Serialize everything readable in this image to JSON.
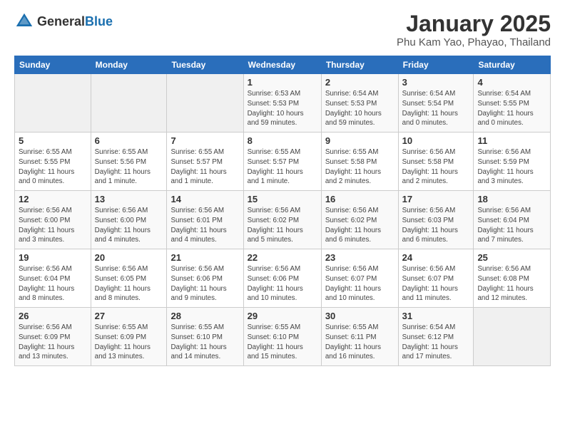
{
  "logo": {
    "general": "General",
    "blue": "Blue"
  },
  "title": "January 2025",
  "subtitle": "Phu Kam Yao, Phayao, Thailand",
  "days_of_week": [
    "Sunday",
    "Monday",
    "Tuesday",
    "Wednesday",
    "Thursday",
    "Friday",
    "Saturday"
  ],
  "weeks": [
    [
      {
        "day": "",
        "detail": ""
      },
      {
        "day": "",
        "detail": ""
      },
      {
        "day": "",
        "detail": ""
      },
      {
        "day": "1",
        "detail": "Sunrise: 6:53 AM\nSunset: 5:53 PM\nDaylight: 10 hours\nand 59 minutes."
      },
      {
        "day": "2",
        "detail": "Sunrise: 6:54 AM\nSunset: 5:53 PM\nDaylight: 10 hours\nand 59 minutes."
      },
      {
        "day": "3",
        "detail": "Sunrise: 6:54 AM\nSunset: 5:54 PM\nDaylight: 11 hours\nand 0 minutes."
      },
      {
        "day": "4",
        "detail": "Sunrise: 6:54 AM\nSunset: 5:55 PM\nDaylight: 11 hours\nand 0 minutes."
      }
    ],
    [
      {
        "day": "5",
        "detail": "Sunrise: 6:55 AM\nSunset: 5:55 PM\nDaylight: 11 hours\nand 0 minutes."
      },
      {
        "day": "6",
        "detail": "Sunrise: 6:55 AM\nSunset: 5:56 PM\nDaylight: 11 hours\nand 1 minute."
      },
      {
        "day": "7",
        "detail": "Sunrise: 6:55 AM\nSunset: 5:57 PM\nDaylight: 11 hours\nand 1 minute."
      },
      {
        "day": "8",
        "detail": "Sunrise: 6:55 AM\nSunset: 5:57 PM\nDaylight: 11 hours\nand 1 minute."
      },
      {
        "day": "9",
        "detail": "Sunrise: 6:55 AM\nSunset: 5:58 PM\nDaylight: 11 hours\nand 2 minutes."
      },
      {
        "day": "10",
        "detail": "Sunrise: 6:56 AM\nSunset: 5:58 PM\nDaylight: 11 hours\nand 2 minutes."
      },
      {
        "day": "11",
        "detail": "Sunrise: 6:56 AM\nSunset: 5:59 PM\nDaylight: 11 hours\nand 3 minutes."
      }
    ],
    [
      {
        "day": "12",
        "detail": "Sunrise: 6:56 AM\nSunset: 6:00 PM\nDaylight: 11 hours\nand 3 minutes."
      },
      {
        "day": "13",
        "detail": "Sunrise: 6:56 AM\nSunset: 6:00 PM\nDaylight: 11 hours\nand 4 minutes."
      },
      {
        "day": "14",
        "detail": "Sunrise: 6:56 AM\nSunset: 6:01 PM\nDaylight: 11 hours\nand 4 minutes."
      },
      {
        "day": "15",
        "detail": "Sunrise: 6:56 AM\nSunset: 6:02 PM\nDaylight: 11 hours\nand 5 minutes."
      },
      {
        "day": "16",
        "detail": "Sunrise: 6:56 AM\nSunset: 6:02 PM\nDaylight: 11 hours\nand 6 minutes."
      },
      {
        "day": "17",
        "detail": "Sunrise: 6:56 AM\nSunset: 6:03 PM\nDaylight: 11 hours\nand 6 minutes."
      },
      {
        "day": "18",
        "detail": "Sunrise: 6:56 AM\nSunset: 6:04 PM\nDaylight: 11 hours\nand 7 minutes."
      }
    ],
    [
      {
        "day": "19",
        "detail": "Sunrise: 6:56 AM\nSunset: 6:04 PM\nDaylight: 11 hours\nand 8 minutes."
      },
      {
        "day": "20",
        "detail": "Sunrise: 6:56 AM\nSunset: 6:05 PM\nDaylight: 11 hours\nand 8 minutes."
      },
      {
        "day": "21",
        "detail": "Sunrise: 6:56 AM\nSunset: 6:06 PM\nDaylight: 11 hours\nand 9 minutes."
      },
      {
        "day": "22",
        "detail": "Sunrise: 6:56 AM\nSunset: 6:06 PM\nDaylight: 11 hours\nand 10 minutes."
      },
      {
        "day": "23",
        "detail": "Sunrise: 6:56 AM\nSunset: 6:07 PM\nDaylight: 11 hours\nand 10 minutes."
      },
      {
        "day": "24",
        "detail": "Sunrise: 6:56 AM\nSunset: 6:07 PM\nDaylight: 11 hours\nand 11 minutes."
      },
      {
        "day": "25",
        "detail": "Sunrise: 6:56 AM\nSunset: 6:08 PM\nDaylight: 11 hours\nand 12 minutes."
      }
    ],
    [
      {
        "day": "26",
        "detail": "Sunrise: 6:56 AM\nSunset: 6:09 PM\nDaylight: 11 hours\nand 13 minutes."
      },
      {
        "day": "27",
        "detail": "Sunrise: 6:55 AM\nSunset: 6:09 PM\nDaylight: 11 hours\nand 13 minutes."
      },
      {
        "day": "28",
        "detail": "Sunrise: 6:55 AM\nSunset: 6:10 PM\nDaylight: 11 hours\nand 14 minutes."
      },
      {
        "day": "29",
        "detail": "Sunrise: 6:55 AM\nSunset: 6:10 PM\nDaylight: 11 hours\nand 15 minutes."
      },
      {
        "day": "30",
        "detail": "Sunrise: 6:55 AM\nSunset: 6:11 PM\nDaylight: 11 hours\nand 16 minutes."
      },
      {
        "day": "31",
        "detail": "Sunrise: 6:54 AM\nSunset: 6:12 PM\nDaylight: 11 hours\nand 17 minutes."
      },
      {
        "day": "",
        "detail": ""
      }
    ]
  ]
}
